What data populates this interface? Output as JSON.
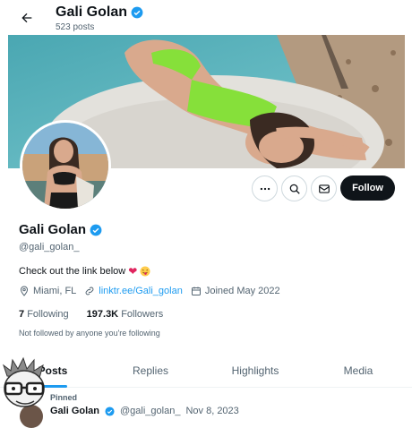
{
  "header": {
    "display_name": "Gali Golan",
    "posts_count": "523 posts"
  },
  "profile": {
    "display_name": "Gali Golan",
    "handle": "@gali_golan_",
    "bio": "Check out the link below",
    "location": "Miami, FL",
    "link": "linktr.ee/Gali_golan",
    "joined": "Joined May 2022",
    "following_count": "7",
    "following_label": "Following",
    "followers_count": "197.3K",
    "followers_label": "Followers",
    "not_followed_note": "Not followed by anyone you're following"
  },
  "actions": {
    "follow_label": "Follow"
  },
  "tabs": [
    {
      "label": "Posts",
      "active": true
    },
    {
      "label": "Replies",
      "active": false
    },
    {
      "label": "Highlights",
      "active": false
    },
    {
      "label": "Media",
      "active": false
    }
  ],
  "pinned_post": {
    "pinned_label": "Pinned",
    "author_name": "Gali Golan",
    "author_handle": "@gali_golan_",
    "date": "Nov 8, 2023"
  },
  "icons": {
    "back": "arrow-left-icon",
    "verified": "verified-badge-icon",
    "more": "more-horizontal-icon",
    "search": "search-icon",
    "message": "envelope-icon",
    "location": "location-pin-icon",
    "link": "link-icon",
    "calendar": "calendar-icon",
    "pin": "pin-icon"
  },
  "colors": {
    "accent": "#1d9bf0",
    "text": "#0f1419",
    "muted": "#536471",
    "follow_button": "#0f1419"
  }
}
